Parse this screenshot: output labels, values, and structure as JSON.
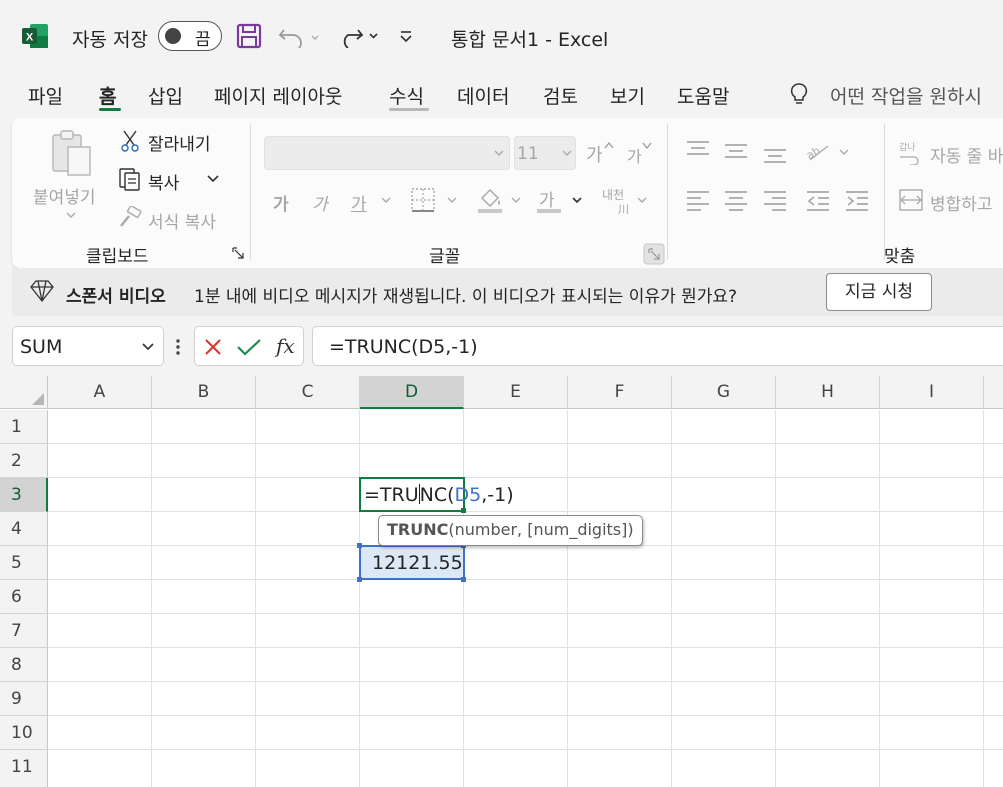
{
  "titlebar": {
    "autosave_label": "자동 저장",
    "autosave_state": "끔",
    "document_title": "통합 문서1  -  Excel"
  },
  "menu": {
    "items": [
      "파일",
      "홈",
      "삽입",
      "페이지 레이아웃",
      "수식",
      "데이터",
      "검토",
      "보기",
      "도움말"
    ],
    "active": "홈",
    "search_placeholder": "어떤 작업을 원하시"
  },
  "ribbon": {
    "clipboard": {
      "paste_label": "붙여넣기",
      "cut_label": "잘라내기",
      "copy_label": "복사",
      "format_painter_label": "서식 복사",
      "group_label": "클립보드"
    },
    "font": {
      "font_name": "",
      "font_size": "11",
      "grow_font": "가",
      "shrink_font": "가",
      "bold": "가",
      "italic": "가",
      "underline": "가",
      "font_color_glyph": "가",
      "phonetic_label": "내천",
      "group_label": "글꼴"
    },
    "alignment": {
      "wrap_text_label": "자동 줄 바",
      "merge_label": "병합하고",
      "group_label": "맞춤"
    }
  },
  "sponsor_bar": {
    "title": "스폰서 비디오",
    "message": "1분 내에 비디오 메시지가 재생됩니다. 이 비디오가 표시되는 이유가 뭔가요?",
    "watch_button": "지금 시청"
  },
  "formula_bar": {
    "name_box": "SUM",
    "formula": "=TRUNC(D5,-1)"
  },
  "sheet": {
    "columns": [
      "A",
      "B",
      "C",
      "D",
      "E",
      "F",
      "G",
      "H",
      "I"
    ],
    "rows": [
      "1",
      "2",
      "3",
      "4",
      "5",
      "6",
      "7",
      "8",
      "9",
      "10",
      "11"
    ],
    "active_column": "D",
    "active_row": "3",
    "editing_cell": {
      "ref": "D3",
      "text_prefix": "=TRU",
      "text_mid": "NC(",
      "ref_text": "D5",
      "text_suffix": ",-1)"
    },
    "referenced_cell": {
      "ref": "D5",
      "value": "12121.55"
    },
    "tooltip": {
      "function_name": "TRUNC",
      "args": "(number, [num_digits])"
    }
  },
  "colors": {
    "accent_green": "#107c41",
    "reference_blue": "#3f73c8"
  }
}
